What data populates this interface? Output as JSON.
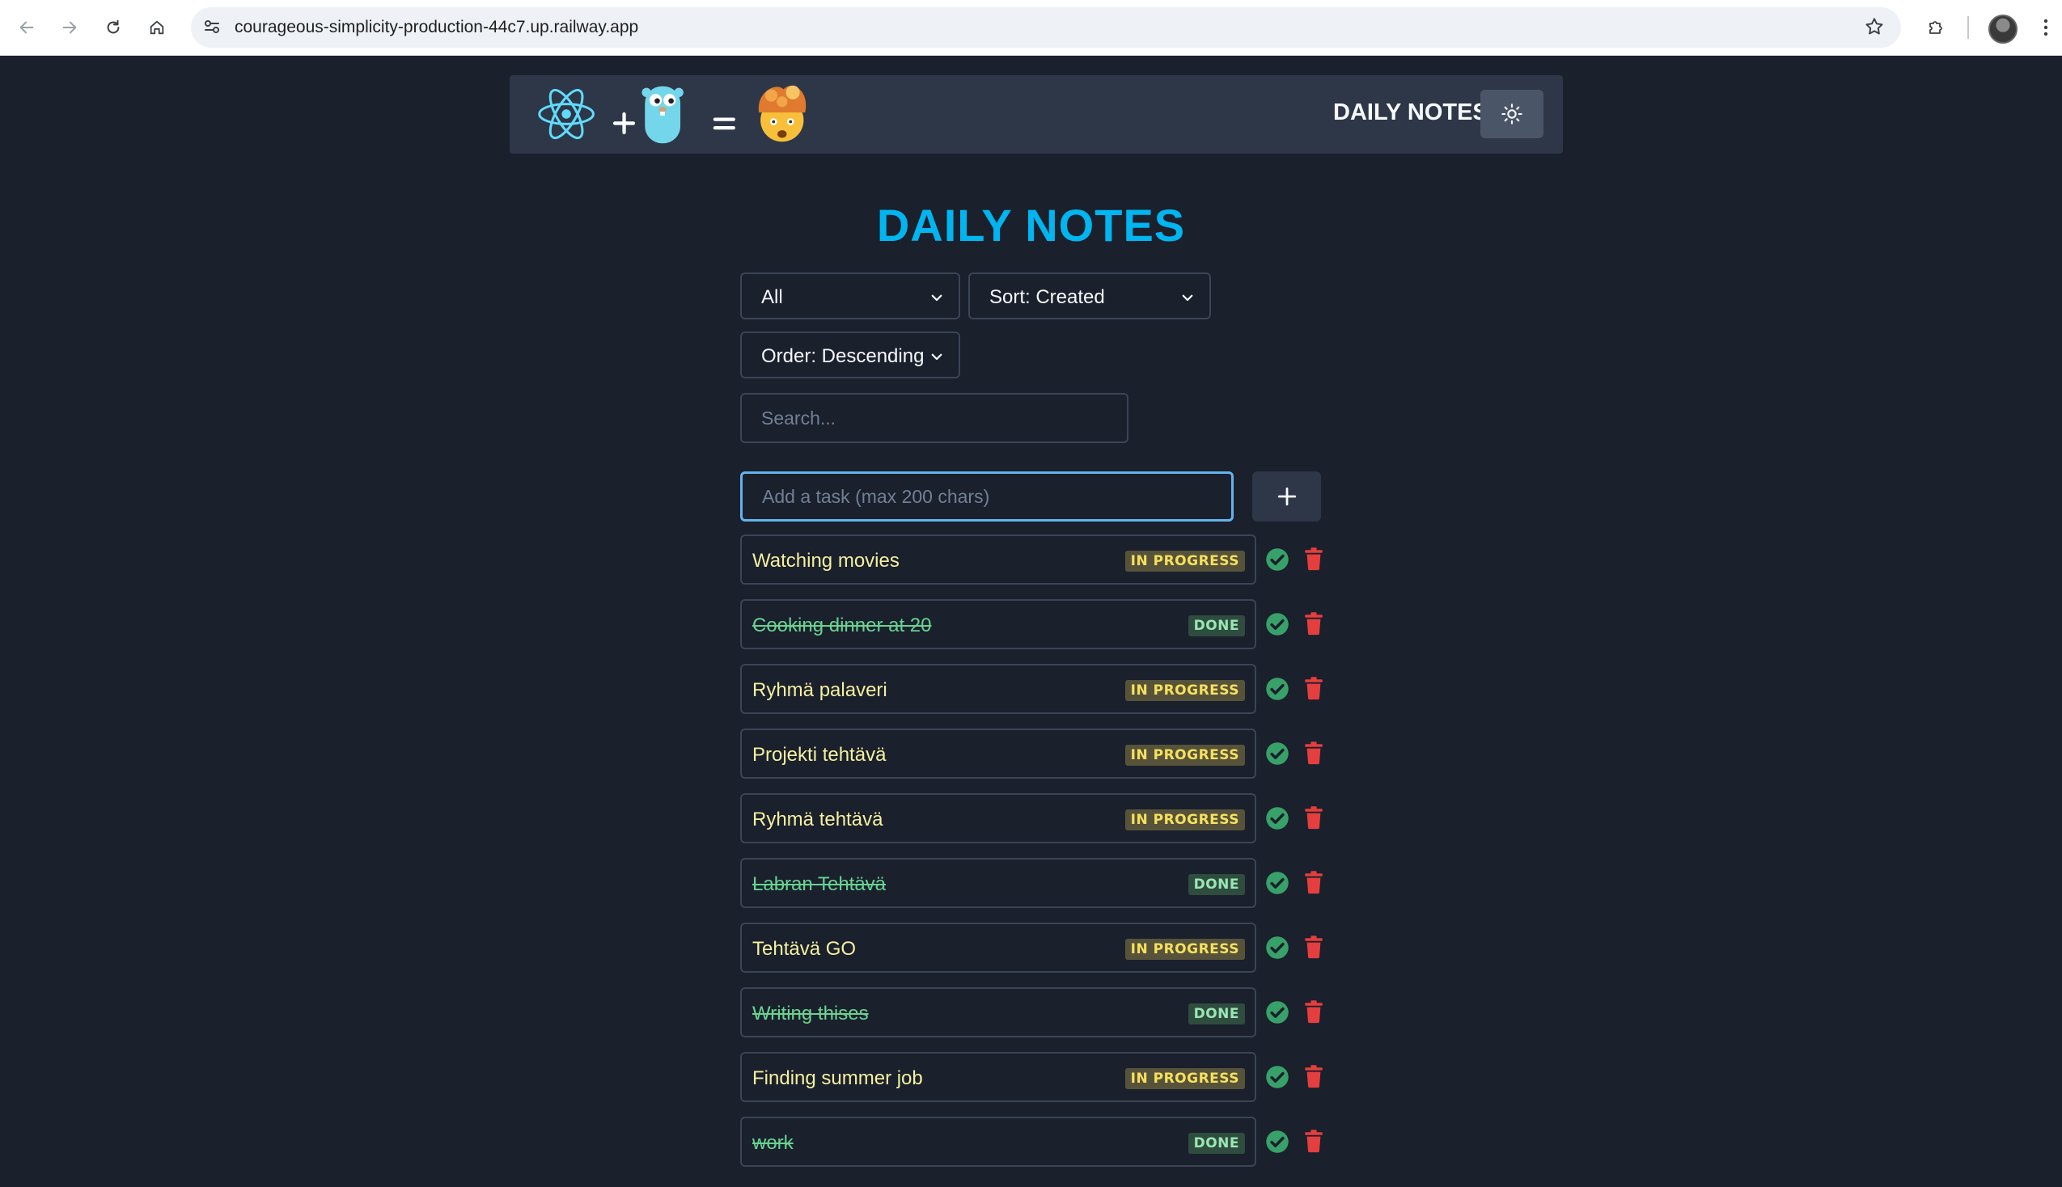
{
  "browser": {
    "url": "courageous-simplicity-production-44c7.up.railway.app"
  },
  "header": {
    "title": "DAILY NOTES",
    "logo": {
      "plus": "+",
      "equals": "=",
      "emoji": "🤯"
    }
  },
  "main": {
    "title": "DAILY NOTES",
    "filter": {
      "value": "All"
    },
    "sort": {
      "value": "Sort: Created"
    },
    "order": {
      "value": "Order: Descending"
    },
    "search": {
      "placeholder": "Search..."
    },
    "task_input": {
      "placeholder": "Add a task (max 200 chars)"
    },
    "add_label": "+"
  },
  "tasks": [
    {
      "text": "Watching movies",
      "status": "IN PROGRESS",
      "done": false
    },
    {
      "text": "Cooking dinner at 20",
      "status": "DONE",
      "done": true
    },
    {
      "text": "Ryhmä palaveri",
      "status": "IN PROGRESS",
      "done": false
    },
    {
      "text": "Projekti tehtävä",
      "status": "IN PROGRESS",
      "done": false
    },
    {
      "text": "Ryhmä tehtävä",
      "status": "IN PROGRESS",
      "done": false
    },
    {
      "text": "Labran Tehtävä",
      "status": "DONE",
      "done": true
    },
    {
      "text": "Tehtävä GO",
      "status": "IN PROGRESS",
      "done": false
    },
    {
      "text": "Writing thises",
      "status": "DONE",
      "done": true
    },
    {
      "text": "Finding summer job",
      "status": "IN PROGRESS",
      "done": false
    },
    {
      "text": "work",
      "status": "DONE",
      "done": true
    }
  ],
  "colors": {
    "accent": "#00b5f0",
    "background": "#1a202c",
    "in_progress": "#f6e05e",
    "done": "#68d391",
    "complete_icon": "#38a169",
    "delete_icon": "#e53e3e"
  }
}
